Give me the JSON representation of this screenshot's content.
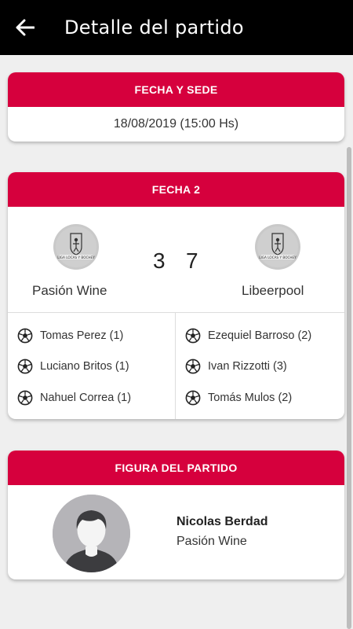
{
  "appbar": {
    "title": "Detalle del partido",
    "back_icon": "arrow-left-icon"
  },
  "venue_card": {
    "header": "FECHA Y SEDE",
    "date": "18/08/2019 (15:00 Hs)"
  },
  "match_card": {
    "header": "FECHA 2",
    "home": {
      "name": "Pasión Wine",
      "score": "3",
      "logo_text": "LIGA LOCAS Y BOCHEY"
    },
    "away": {
      "name": "Libeerpool",
      "score": "7",
      "logo_text": "LIGA LOCAS Y BOCHEY"
    },
    "home_scorers": [
      "Tomas Perez (1)",
      "Luciano Britos (1)",
      "Nahuel Correa (1)"
    ],
    "away_scorers": [
      "Ezequiel Barroso (2)",
      "Ivan Rizzotti (3)",
      "Tomás Mulos (2)"
    ]
  },
  "mvp_card": {
    "header": "FIGURA DEL PARTIDO",
    "name": "Nicolas Berdad",
    "team": "Pasión Wine"
  },
  "colors": {
    "accent": "#d6003d",
    "appbar": "#000000",
    "background": "#efefef"
  }
}
